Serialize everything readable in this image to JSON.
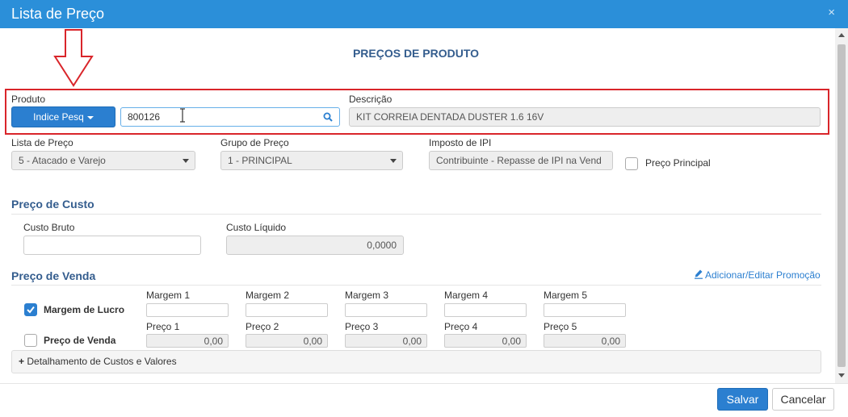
{
  "window": {
    "title": "Lista de Preço",
    "close_glyph": "×"
  },
  "heading": "PREÇOS DE PRODUTO",
  "produto": {
    "label": "Produto",
    "search_mode_button": "Indice Pesq",
    "code_value": "800126"
  },
  "descricao": {
    "label": "Descrição",
    "value": "KIT CORREIA DENTADA DUSTER 1.6 16V"
  },
  "lista_preco": {
    "label": "Lista de Preço",
    "selected": "5 - Atacado e Varejo"
  },
  "grupo_preco": {
    "label": "Grupo de Preço",
    "selected": "1 - PRINCIPAL"
  },
  "imposto_ipi": {
    "label": "Imposto de IPI",
    "value": "Contribuinte - Repasse de IPI na Vend"
  },
  "preco_principal": {
    "label": "Preço Principal",
    "checked": false
  },
  "preco_custo": {
    "section_title": "Preço de Custo",
    "custo_bruto": {
      "label": "Custo Bruto",
      "value": ""
    },
    "custo_liquido": {
      "label": "Custo Líquido",
      "value": "0,0000"
    }
  },
  "preco_venda": {
    "section_title": "Preço de Venda",
    "promo_link": "Adicionar/Editar Promoção",
    "margem_lucro": {
      "label": "Margem de Lucro",
      "checked": true
    },
    "preco_venda_opt": {
      "label": "Preço de Venda",
      "checked": false
    },
    "margens": [
      {
        "label": "Margem 1",
        "value": ""
      },
      {
        "label": "Margem 2",
        "value": ""
      },
      {
        "label": "Margem 3",
        "value": ""
      },
      {
        "label": "Margem 4",
        "value": ""
      },
      {
        "label": "Margem 5",
        "value": ""
      }
    ],
    "precos": [
      {
        "label": "Preço 1",
        "value": "0,00"
      },
      {
        "label": "Preço 2",
        "value": "0,00"
      },
      {
        "label": "Preço 3",
        "value": "0,00"
      },
      {
        "label": "Preço 4",
        "value": "0,00"
      },
      {
        "label": "Preço 5",
        "value": "0,00"
      }
    ]
  },
  "detalhamento": {
    "label": "Detalhamento de Custos e Valores",
    "plus_glyph": "+"
  },
  "footer": {
    "save_label": "Salvar",
    "cancel_label": "Cancelar"
  },
  "colors": {
    "accent": "#2b8fd9",
    "primary_button": "#2b7fd0",
    "section_title": "#345d8e",
    "highlight_border": "#d9252a"
  }
}
